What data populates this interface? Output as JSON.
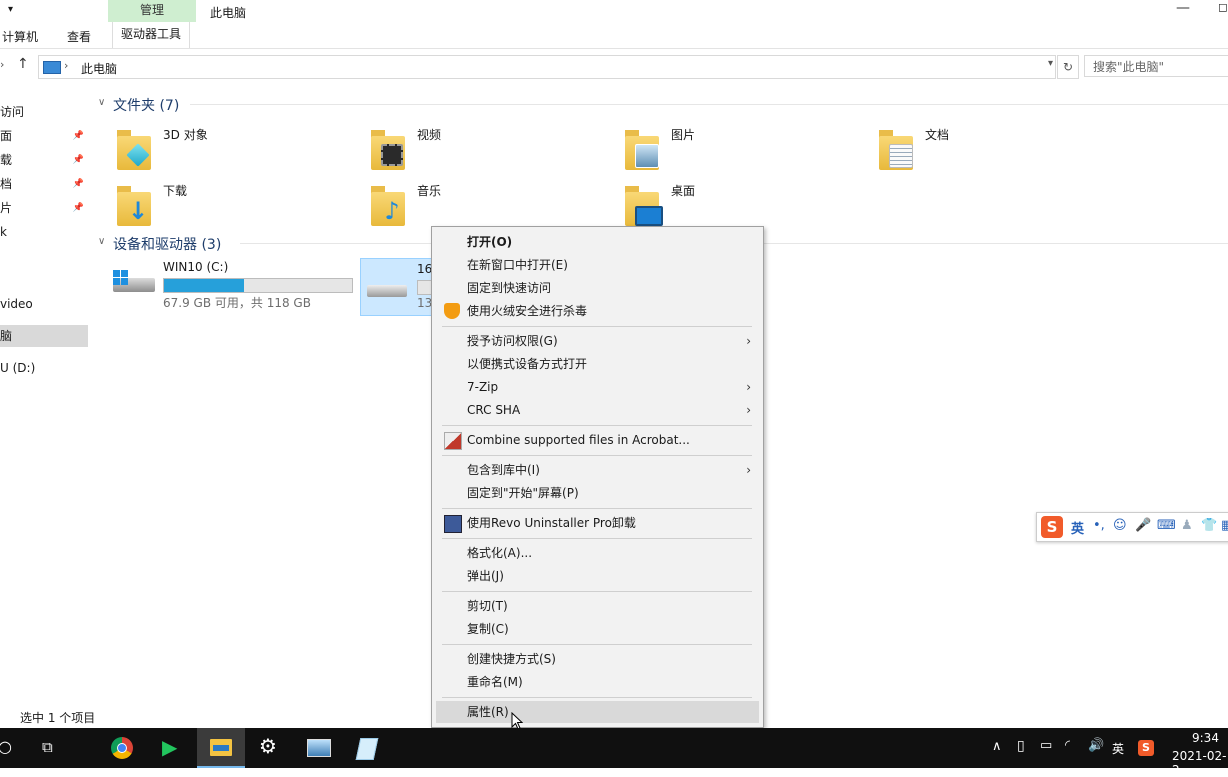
{
  "ribbon": {
    "context_tab": "管理",
    "window_title": "此电脑",
    "tabs": [
      "计算机",
      "查看",
      "驱动器工具"
    ]
  },
  "address": {
    "path": "此电脑",
    "search_placeholder": "搜索\"此电脑\""
  },
  "nav": {
    "items": [
      {
        "label": "访问",
        "pinned": false
      },
      {
        "label": "面",
        "pinned": true
      },
      {
        "label": "载",
        "pinned": true
      },
      {
        "label": "档",
        "pinned": true
      },
      {
        "label": "片",
        "pinned": true
      },
      {
        "label": "k",
        "pinned": false
      },
      {
        "label": "video",
        "pinned": false
      },
      {
        "label": "脑",
        "pinned": false,
        "selected": true
      },
      {
        "label": "U (D:)",
        "pinned": false
      }
    ]
  },
  "folders_group": {
    "header": "文件夹 (7)",
    "items": [
      {
        "label": "3D 对象",
        "icon": "3d-objects-folder-icon"
      },
      {
        "label": "视频",
        "icon": "videos-folder-icon"
      },
      {
        "label": "图片",
        "icon": "pictures-folder-icon"
      },
      {
        "label": "文档",
        "icon": "documents-folder-icon"
      },
      {
        "label": "下载",
        "icon": "downloads-folder-icon"
      },
      {
        "label": "音乐",
        "icon": "music-folder-icon"
      },
      {
        "label": "桌面",
        "icon": "desktop-folder-icon"
      }
    ]
  },
  "drives_group": {
    "header": "设备和驱动器 (3)",
    "drives": [
      {
        "name": "WIN10 (C:)",
        "sub": "67.9 GB 可用，共 118 GB",
        "used_fraction": 0.425
      },
      {
        "name": "16",
        "sub": "13",
        "used_fraction": 0.1,
        "selected": true
      }
    ]
  },
  "context_menu": {
    "items": [
      {
        "label": "打开(O)",
        "bold": true
      },
      {
        "label": "在新窗口中打开(E)"
      },
      {
        "label": "固定到快速访问"
      },
      {
        "label": "使用火绒安全进行杀毒",
        "icon": "huorong-shield-icon"
      },
      {
        "sep": true
      },
      {
        "label": "授予访问权限(G)",
        "submenu": true
      },
      {
        "label": "以便携式设备方式打开"
      },
      {
        "label": "7-Zip",
        "submenu": true
      },
      {
        "label": "CRC SHA",
        "submenu": true
      },
      {
        "sep": true
      },
      {
        "label": "Combine supported files in Acrobat...",
        "icon": "acrobat-icon"
      },
      {
        "sep": true
      },
      {
        "label": "包含到库中(I)",
        "submenu": true
      },
      {
        "label": "固定到\"开始\"屏幕(P)"
      },
      {
        "sep": true
      },
      {
        "label": "使用Revo Uninstaller Pro卸载",
        "icon": "revo-uninstaller-icon"
      },
      {
        "sep": true
      },
      {
        "label": "格式化(A)..."
      },
      {
        "label": "弹出(J)"
      },
      {
        "sep": true
      },
      {
        "label": "剪切(T)"
      },
      {
        "label": "复制(C)"
      },
      {
        "sep": true
      },
      {
        "label": "创建快捷方式(S)"
      },
      {
        "label": "重命名(M)"
      },
      {
        "sep": true
      },
      {
        "label": "属性(R)",
        "hover": true
      }
    ]
  },
  "sogou": {
    "logo": "S",
    "mode": "英"
  },
  "status": {
    "text": "选中 1 个项目"
  },
  "taskbar": {
    "time": "9:34",
    "date": "2021-02-2",
    "ime": "英"
  },
  "colors": {
    "accent": "#26a0da",
    "selection": "#cce8ff",
    "context_tab": "#cfeed0"
  }
}
